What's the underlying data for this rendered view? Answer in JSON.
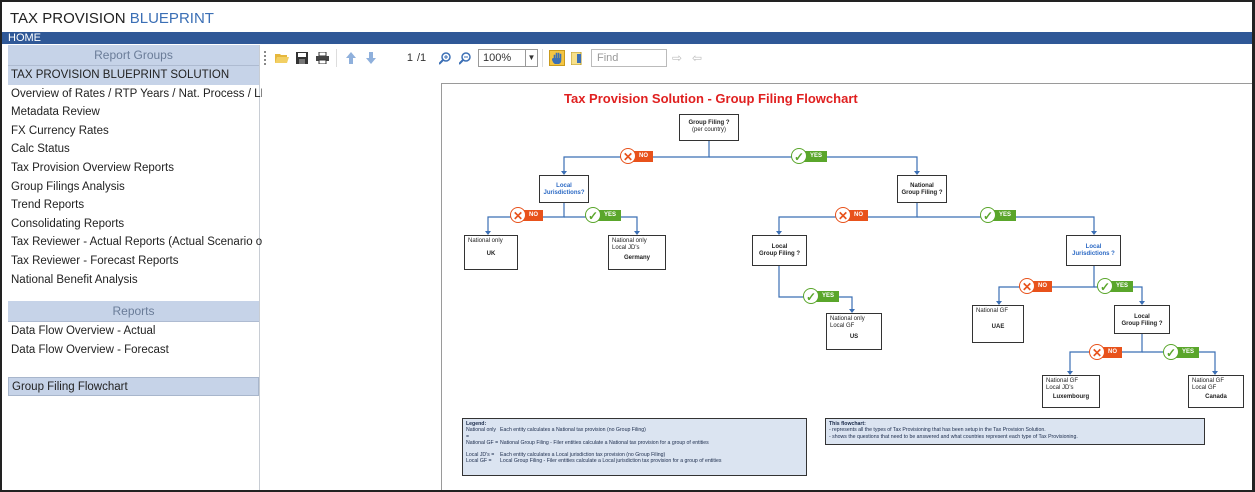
{
  "app": {
    "title_part1": "TAX PROVISION",
    "title_part2": "BLUEPRINT",
    "home_label": "HOME"
  },
  "sidebar": {
    "report_groups_header": "Report Groups",
    "report_groups": [
      "TAX PROVISION BLUEPRINT SOLUTION",
      "Overview of Rates / RTP Years / Nat. Process / LNB",
      "Metadata Review",
      "FX Currency Rates",
      "Calc Status",
      "Tax Provision Overview Reports",
      "Group Filings Analysis",
      "Trend Reports",
      "Consolidating Reports",
      "Tax Reviewer - Actual Reports  (Actual Scenario only)",
      "Tax Reviewer - Forecast Reports",
      "National Benefit Analysis"
    ],
    "reports_header": "Reports",
    "reports": [
      "Data Flow Overview - Actual",
      "Data Flow Overview - Forecast",
      "Group Filing Flowchart"
    ],
    "selected_report": "Group Filing Flowchart"
  },
  "toolbar": {
    "page_current": "1",
    "page_total": "/1",
    "zoom": "100%",
    "find_placeholder": "Find",
    "icons": [
      "open-folder-icon",
      "save-icon",
      "print-icon",
      "arrow-up-icon",
      "arrow-down-icon",
      "zoom-in-icon",
      "zoom-out-icon",
      "hand-icon",
      "bookmark-icon",
      "find-next-icon",
      "find-prev-icon"
    ]
  },
  "report": {
    "title": "Tax Provision Solution - Group Filing Flowchart",
    "root": {
      "line1": "Group Filing ?",
      "line2": "(per country)"
    },
    "nodes": {
      "local_jur_1": {
        "line1": "Local",
        "line2": "Jurisdictions?"
      },
      "national_gf": {
        "line1": "National",
        "line2": "Group Filing ?"
      },
      "local_gf_1": {
        "line1": "Local",
        "line2": "Group Filing ?"
      },
      "local_jur_2": {
        "line1": "Local",
        "line2": "Jurisdictions ?"
      },
      "local_gf_2": {
        "line1": "Local",
        "line2": "Group Filing ?"
      }
    },
    "leaves": {
      "uk": {
        "lines": [
          "National only"
        ],
        "country": "UK"
      },
      "germany": {
        "lines": [
          "National only",
          "Local JD's"
        ],
        "country": "Germany"
      },
      "us": {
        "lines": [
          "National only",
          "Local GF"
        ],
        "country": "US"
      },
      "uae": {
        "lines": [
          "National GF"
        ],
        "country": "UAE"
      },
      "luxembourg": {
        "lines": [
          "National GF",
          "Local JD's"
        ],
        "country": "Luxembourg"
      },
      "canada": {
        "lines": [
          "National GF",
          "Local GF"
        ],
        "country": "Canada"
      }
    },
    "badge_no": "NO",
    "badge_yes": "YES",
    "legend": {
      "title": "Legend:",
      "rows1": [
        {
          "k": "National only =",
          "v": "Each entity calculates a National tax provision (no Group Filing)"
        },
        {
          "k": "National GF =",
          "v": "National Group Filing - Filer entities calculate a National tax provision for a group of entities"
        }
      ],
      "rows2": [
        {
          "k": "Local JD's =",
          "v": "Each entity calculates a Local jurisdiction tax provision (no Group Filing)"
        },
        {
          "k": "Local GF =",
          "v": "Local Group Filing - Filer entities calculate a Local jurisdiction tax provision for a group of entities"
        }
      ]
    },
    "note": {
      "title": "This flowchart:",
      "lines": [
        "- represents all the types of Tax Provisioning that has been setup in the Tax Provision Solution.",
        "- shows the questions that need to be answered and what countries represent each type of Tax Provisioning."
      ]
    }
  },
  "colors": {
    "accent": "#2f5897",
    "header_bg": "#c6d3e8",
    "no": "#e8521b",
    "yes": "#5aa62b",
    "title_red": "#e02020",
    "line": "#3b6fb5"
  }
}
